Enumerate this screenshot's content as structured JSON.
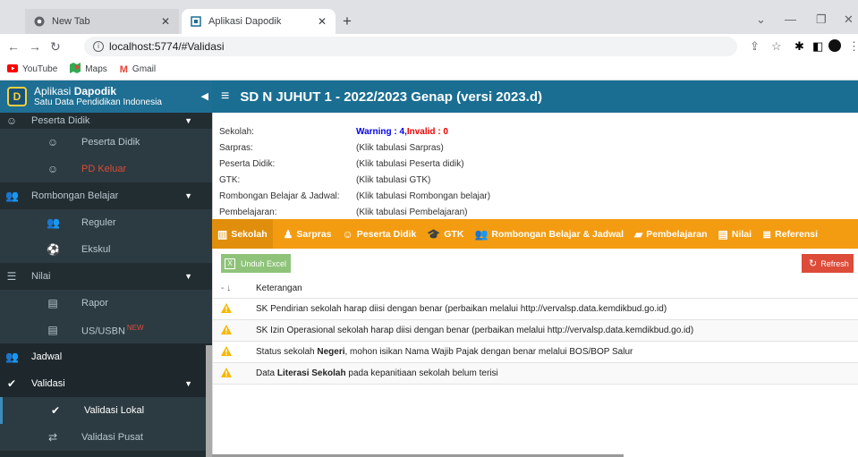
{
  "browser": {
    "tabs": [
      {
        "label": "New Tab"
      },
      {
        "label": "Aplikasi Dapodik"
      }
    ],
    "url": "localhost:5774/#Validasi",
    "bookmarks": [
      {
        "label": "YouTube"
      },
      {
        "label": "Maps"
      },
      {
        "label": "Gmail"
      }
    ]
  },
  "app": {
    "brand_title_prefix": "Aplikasi ",
    "brand_title_bold": "Dapodik",
    "brand_subtitle": "Satu Data Pendidikan Indonesia",
    "header_title": "SD N JUHUT 1 - 2022/2023 Genap (versi 2023.d)"
  },
  "sidebar": {
    "items": [
      {
        "label": "Peserta Didik",
        "icon": "smile-icon"
      },
      {
        "label": "Peserta Didik",
        "icon": "smile-icon"
      },
      {
        "label": "PD Keluar",
        "icon": "smile-icon",
        "color": "#dd4b39"
      },
      {
        "label": "Rombongan Belajar",
        "icon": "users-icon"
      },
      {
        "label": "Reguler",
        "icon": "users-icon"
      },
      {
        "label": "Ekskul",
        "icon": "soccer-icon"
      },
      {
        "label": "Nilai",
        "icon": "list-icon"
      },
      {
        "label": "Rapor",
        "icon": "file-icon"
      },
      {
        "label": "US/USBN",
        "badge": "NEW",
        "icon": "file-icon"
      },
      {
        "label": "Jadwal",
        "icon": "users-icon"
      },
      {
        "label": "Validasi",
        "icon": "check-icon"
      },
      {
        "label": "Validasi Lokal",
        "icon": "check-icon"
      },
      {
        "label": "Validasi Pusat",
        "icon": "exchange-icon"
      }
    ]
  },
  "summary": {
    "rows": [
      {
        "key": "Sekolah:",
        "warning": "Warning : 4",
        "sep": ", ",
        "invalid": "Invalid : 0"
      },
      {
        "key": "Sarpras:",
        "value": "(Klik tabulasi Sarpras)"
      },
      {
        "key": "Peserta Didik:",
        "value": "(Klik tabulasi Peserta didik)"
      },
      {
        "key": "GTK:",
        "value": "(Klik tabulasi GTK)"
      },
      {
        "key": "Rombongan Belajar & Jadwal:",
        "value": "(Klik tabulasi Rombongan belajar)"
      },
      {
        "key": "Pembelajaran:",
        "value": "(Klik tabulasi Pembelajaran)"
      }
    ]
  },
  "tabs": [
    {
      "label": "Sekolah",
      "icon": "building-icon"
    },
    {
      "label": "Sarpras",
      "icon": "people-icon"
    },
    {
      "label": "Peserta Didik",
      "icon": "smile-icon"
    },
    {
      "label": "GTK",
      "icon": "graduation-icon"
    },
    {
      "label": "Rombongan Belajar & Jadwal",
      "icon": "users-icon"
    },
    {
      "label": "Pembelajaran",
      "icon": "book-icon"
    },
    {
      "label": "Nilai",
      "icon": "file-icon"
    },
    {
      "label": "Referensi",
      "icon": "database-icon"
    }
  ],
  "toolbar": {
    "excel_label": "Unduh Excel",
    "refresh_label": "Refresh"
  },
  "table": {
    "sort_header": "- ↓",
    "col_header": "Keterangan",
    "rows": [
      {
        "text_pre": "SK Pendirian sekolah harap diisi dengan benar (perbaikan melalui http://vervalsp.data.kemdikbud.go.id)",
        "bold": "",
        "text_post": ""
      },
      {
        "text_pre": "SK Izin Operasional sekolah harap diisi dengan benar (perbaikan melalui http://vervalsp.data.kemdikbud.go.id)",
        "bold": "",
        "text_post": ""
      },
      {
        "text_pre": "Status sekolah ",
        "bold": "Negeri",
        "text_post": ", mohon isikan Nama Wajib Pajak dengan benar melalui BOS/BOP Salur"
      },
      {
        "text_pre": "Data ",
        "bold": "Literasi Sekolah",
        "text_post": " pada kepanitiaan sekolah belum terisi"
      }
    ]
  },
  "colors": {
    "header_bg": "#1a6e92",
    "tabs_bg": "#f39c12",
    "sidebar_bg": "#222d32",
    "warning_color": "#0000ee",
    "invalid_color": "#ee0000",
    "refresh_bg": "#dd4b39",
    "excel_bg": "#8fc37a"
  }
}
